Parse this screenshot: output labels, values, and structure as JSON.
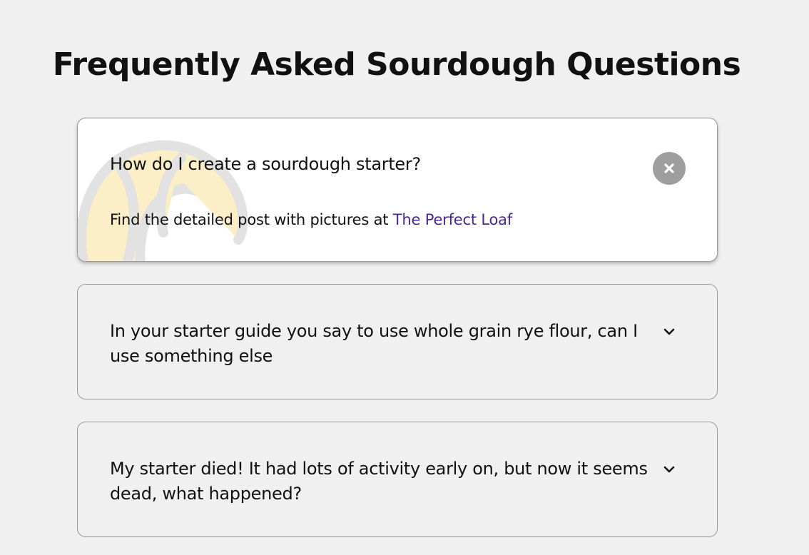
{
  "page": {
    "title": "Frequently Asked Sourdough Questions"
  },
  "faqs": [
    {
      "question": "How do I create a sourdough starter?",
      "expanded": true,
      "answer_prefix": "Find the detailed post with pictures at ",
      "answer_link_text": "The Perfect Loaf",
      "toggle_icon": "close-icon",
      "decoration_icon": "croissant-icon"
    },
    {
      "question": "In your starter guide you say to use whole grain rye flour, can I use something else",
      "expanded": false,
      "toggle_icon": "chevron-down-icon"
    },
    {
      "question": "My starter died! It had lots of activity early on, but now it seems dead, what happened?",
      "expanded": false,
      "toggle_icon": "chevron-down-icon"
    }
  ],
  "colors": {
    "background": "#f0f0f0",
    "card_active": "#ffffff",
    "link": "#4a2791",
    "close_button": "#9e9e9e",
    "decoration_fill": "#fcefc7",
    "decoration_stroke": "#e2e2e2"
  }
}
